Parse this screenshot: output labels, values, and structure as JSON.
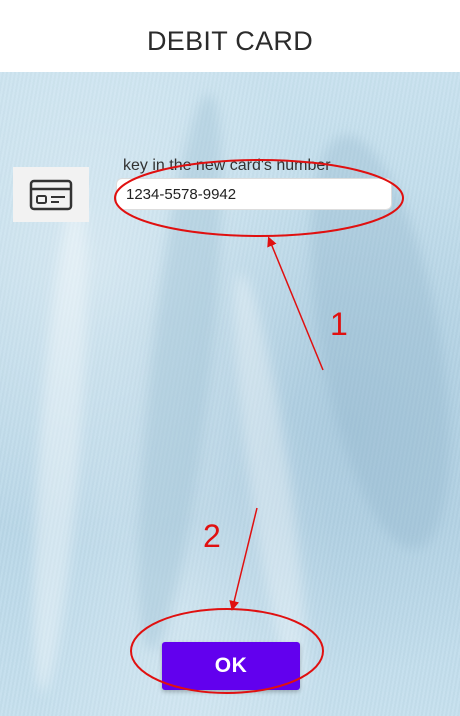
{
  "header": {
    "title": "DEBIT CARD"
  },
  "card_field": {
    "icon": "credit-card-icon",
    "label": "key in the new card's number",
    "value": "1234-5578-9942"
  },
  "actions": {
    "ok_label": "OK"
  },
  "annotations": {
    "step_1": "1",
    "step_2": "2",
    "color": "#e01010"
  },
  "colors": {
    "button": "#6200ee",
    "background": "#bcd9e9"
  }
}
